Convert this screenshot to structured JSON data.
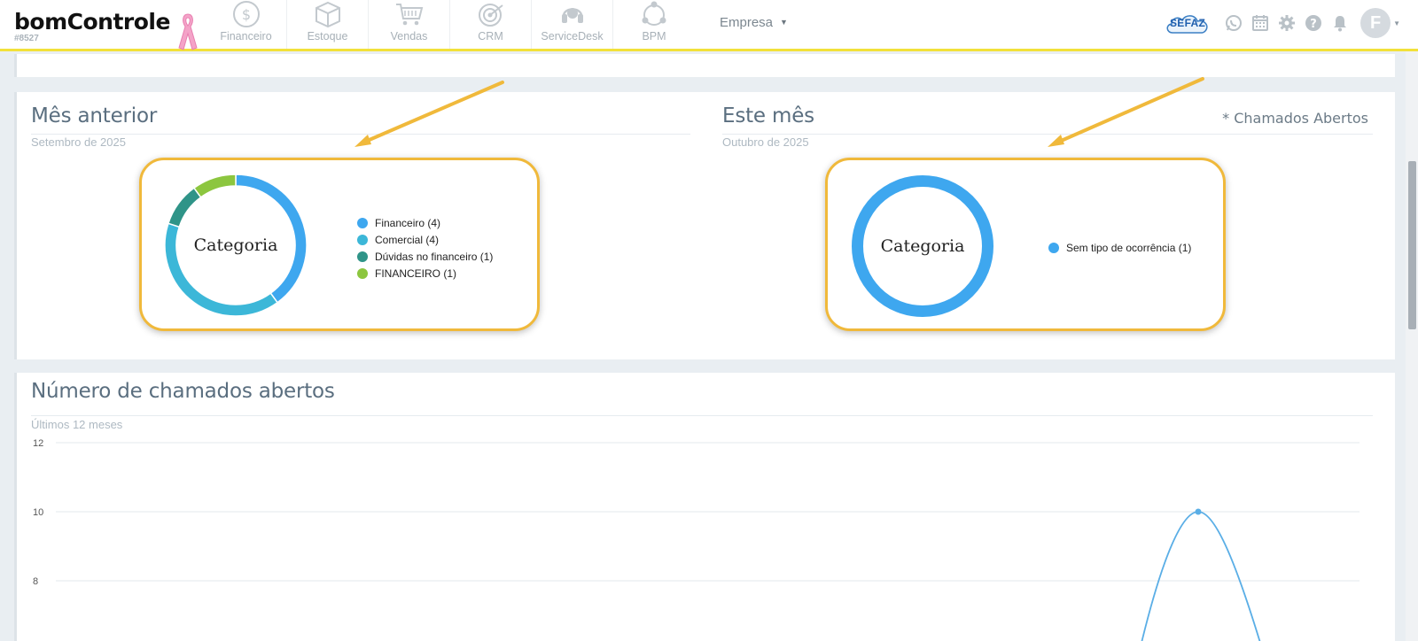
{
  "brand": {
    "name": "bomControle",
    "id": "#8527"
  },
  "nav": {
    "modules": [
      {
        "label": "Financeiro",
        "icon": "dollar-circle-icon"
      },
      {
        "label": "Estoque",
        "icon": "box-icon"
      },
      {
        "label": "Vendas",
        "icon": "cart-icon"
      },
      {
        "label": "CRM",
        "icon": "target-icon"
      },
      {
        "label": "ServiceDesk",
        "icon": "headset-icon"
      },
      {
        "label": "BPM",
        "icon": "workflow-icon"
      }
    ],
    "company_label": "Empresa",
    "sefaz_label": "SEFAZ",
    "avatar_initial": "F"
  },
  "prev_month": {
    "title": "Mês anterior",
    "subtitle": "Setembro de 2025",
    "center_label": "Categoria",
    "legend": [
      {
        "label": "Financeiro (4)",
        "color": "#3ea7ef"
      },
      {
        "label": "Comercial (4)",
        "color": "#3cb7d8"
      },
      {
        "label": "Dúvidas no financeiro (1)",
        "color": "#2f9488"
      },
      {
        "label": "FINANCEIRO (1)",
        "color": "#8cc63f"
      }
    ]
  },
  "this_month": {
    "title": "Este mês",
    "subtitle": "Outubro de 2025",
    "note": "* Chamados Abertos",
    "center_label": "Categoria",
    "legend": [
      {
        "label": "Sem tipo de ocorrência (1)",
        "color": "#3ea7ef"
      }
    ]
  },
  "tickets": {
    "title": "Número de chamados abertos",
    "subtitle": "Últimos 12 meses"
  },
  "chart_data": [
    {
      "type": "pie",
      "title": "Categoria",
      "categories": [
        "Financeiro",
        "Comercial",
        "Dúvidas no financeiro",
        "FINANCEIRO"
      ],
      "values": [
        4,
        4,
        1,
        1
      ],
      "colors": [
        "#3ea7ef",
        "#3cb7d8",
        "#2f9488",
        "#8cc63f"
      ]
    },
    {
      "type": "pie",
      "title": "Categoria",
      "categories": [
        "Sem tipo de ocorrência"
      ],
      "values": [
        1
      ],
      "colors": [
        "#3ea7ef"
      ]
    },
    {
      "type": "line",
      "title": "Número de chamados abertos",
      "yticks": [
        8,
        10,
        12
      ],
      "ylim": [
        6.5,
        12
      ],
      "grid": true,
      "visible_points": [
        {
          "y": 10
        }
      ],
      "line_color": "#5aaee6"
    }
  ]
}
